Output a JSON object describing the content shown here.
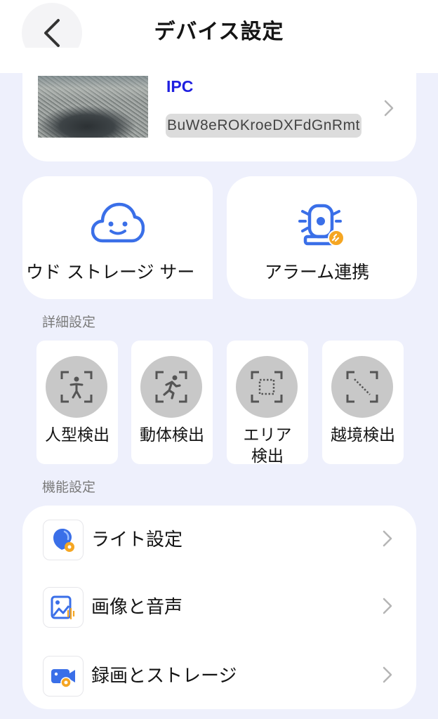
{
  "header": {
    "title": "デバイス設定",
    "back_icon": "chevron-left-icon"
  },
  "device": {
    "name": "IPC",
    "id": "BuW8eROKroeDXFdGnRmt"
  },
  "quick_tiles": [
    {
      "label": "ウド ストレージ サー",
      "icon": "cloud-face-icon"
    },
    {
      "label": "アラーム連携",
      "icon": "alarm-siren-link-icon"
    }
  ],
  "detection": {
    "section_label": "詳細設定",
    "items": [
      {
        "label": "人型検出",
        "icon": "human-detect-icon"
      },
      {
        "label": "動体検出",
        "icon": "motion-detect-icon"
      },
      {
        "label": "エリア\n検出",
        "label_line1": "エリア",
        "label_line2": "検出",
        "icon": "area-detect-icon"
      },
      {
        "label": "越境検出",
        "icon": "line-cross-detect-icon"
      }
    ]
  },
  "features": {
    "section_label": "機能設定",
    "items": [
      {
        "label": "ライト設定",
        "icon": "light-bulb-gear-icon"
      },
      {
        "label": "画像と音声",
        "icon": "image-sound-icon"
      },
      {
        "label": "録画とストレージ",
        "icon": "video-gear-icon"
      }
    ]
  },
  "colors": {
    "accent": "#3a6fe8",
    "background": "#eef0fc",
    "device_name": "#1f1fe0"
  }
}
